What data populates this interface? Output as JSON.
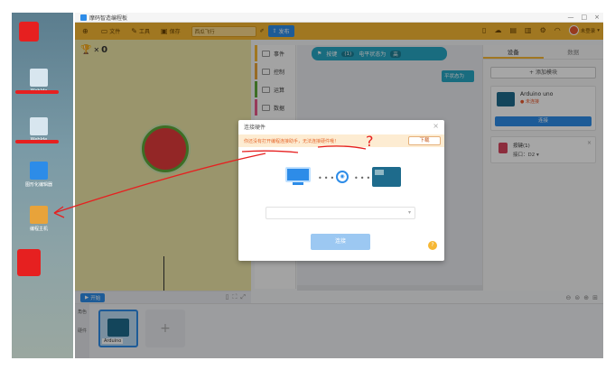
{
  "window": {
    "title": "摩码智造编程板",
    "controls": [
      "—",
      "□",
      "×"
    ]
  },
  "toolbar": {
    "file": "文件",
    "tools": "工具",
    "save": "保存",
    "project_name": "西瓜飞行",
    "upload": "发布",
    "user": "未登录"
  },
  "stage": {
    "counter": "0",
    "start": "开始"
  },
  "categories": [
    {
      "label": "事件",
      "color": "#f6b734"
    },
    {
      "label": "控制",
      "color": "#e8a33a"
    },
    {
      "label": "运算",
      "color": "#5fa93a"
    },
    {
      "label": "数据",
      "color": "#e85a8a"
    }
  ],
  "script": {
    "block_label": "按键",
    "block_pin": "(1)",
    "block_state_label": "电平状态为",
    "block_state_value": "高",
    "block2": "平状态为"
  },
  "right_panel": {
    "tabs": [
      "设备",
      "数据"
    ],
    "add_module": "添加模块",
    "device": {
      "name": "Arduino uno",
      "status": "未连接",
      "connect": "连接"
    },
    "button_module": {
      "name": "按键(1)",
      "port_label": "接口：",
      "port_value": "D2"
    }
  },
  "sprite_panel": {
    "tabs": [
      "角色",
      "硬件"
    ],
    "card_label": "Arduino"
  },
  "desktop": {
    "icons": [
      "WebIde",
      "WebIde",
      "图形化编辑器",
      "编程主机"
    ]
  },
  "modal": {
    "title": "连接硬件",
    "warning": "你还没有打开编程连接助手，无法连接硬件哦！",
    "download": "下载",
    "connect": "连接",
    "select_placeholder": "",
    "help": "?"
  },
  "annotation": {
    "mark": "?"
  }
}
